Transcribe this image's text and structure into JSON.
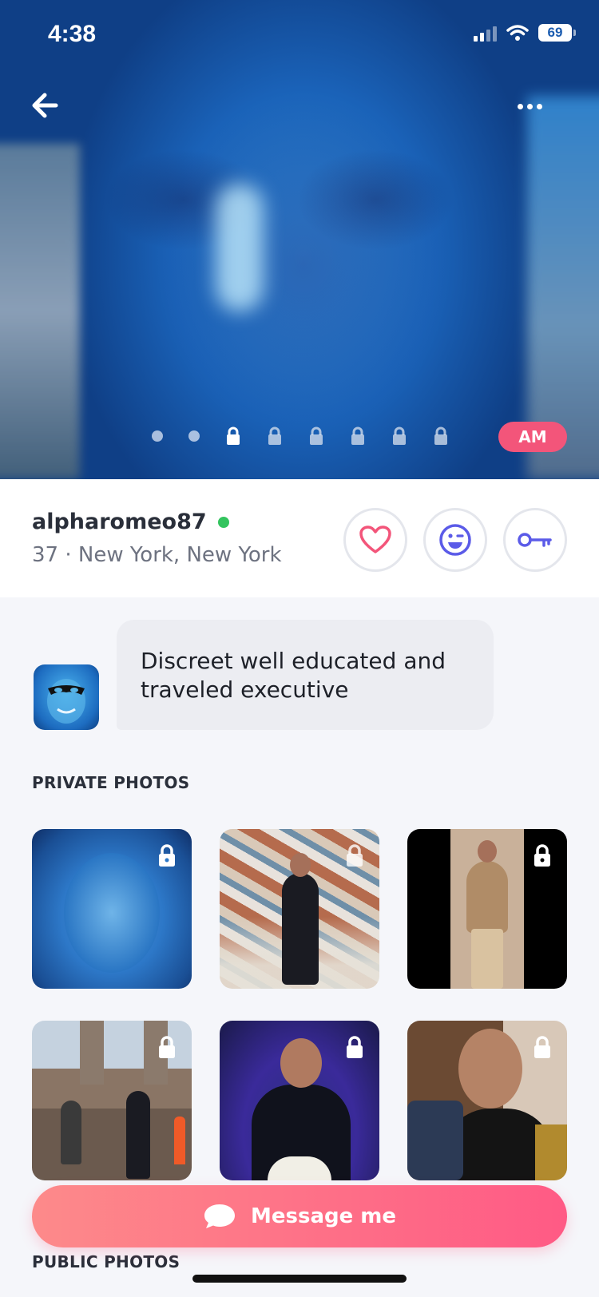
{
  "status_bar": {
    "time": "4:38",
    "battery": "69"
  },
  "hero": {
    "badge": "AM",
    "photo_dots_unlocked": 2,
    "photo_dots_locked": 6
  },
  "profile": {
    "username": "alpharomeo87",
    "details": "37 · New York, New York",
    "online": true
  },
  "bio": {
    "text": "Discreet well educated and traveled executive"
  },
  "sections": {
    "private_photos": "PRIVATE PHOTOS",
    "public_photos": "PUBLIC PHOTOS"
  },
  "actions": {
    "message_label": "Message me"
  },
  "icons": {
    "back": "arrow-left-icon",
    "more": "ellipsis-icon",
    "like": "heart-icon",
    "wink": "wink-emoji-icon",
    "key": "key-icon",
    "lock": "lock-icon",
    "message": "chat-bubble-icon"
  },
  "colors": {
    "accent": "#f3557a",
    "online": "#33c45e",
    "heart": "#f3557a",
    "purple": "#5b5be8"
  }
}
